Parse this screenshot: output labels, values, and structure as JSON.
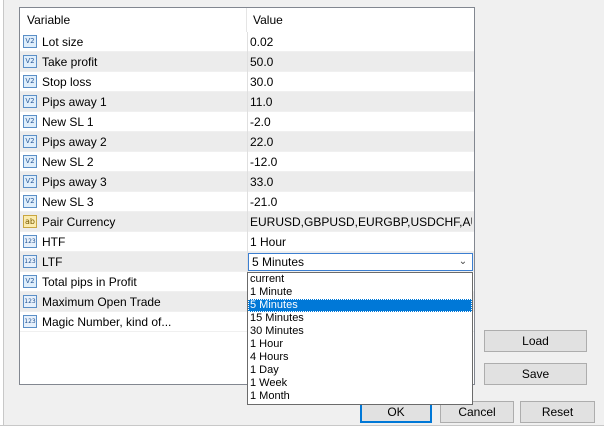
{
  "grid": {
    "headers": {
      "variable": "Variable",
      "value": "Value"
    },
    "rows": [
      {
        "icon": "double",
        "name": "Lot size",
        "value": "0.02"
      },
      {
        "icon": "double",
        "name": "Take profit",
        "value": "50.0"
      },
      {
        "icon": "double",
        "name": "Stop loss",
        "value": "30.0"
      },
      {
        "icon": "double",
        "name": "Pips away 1",
        "value": "11.0"
      },
      {
        "icon": "double",
        "name": "New SL 1",
        "value": "-2.0"
      },
      {
        "icon": "double",
        "name": "Pips away 2",
        "value": "22.0"
      },
      {
        "icon": "double",
        "name": "New SL 2",
        "value": "-12.0"
      },
      {
        "icon": "double",
        "name": "Pips away 3",
        "value": "33.0"
      },
      {
        "icon": "double",
        "name": "New SL 3",
        "value": "-21.0"
      },
      {
        "icon": "string",
        "name": "Pair Currency",
        "value": "EURUSD,GBPUSD,EURGBP,USDCHF,AU..."
      },
      {
        "icon": "integer",
        "name": "HTF",
        "value": "1 Hour"
      },
      {
        "icon": "integer",
        "name": "LTF",
        "value": "5 Minutes"
      },
      {
        "icon": "double",
        "name": "Total pips in Profit",
        "value": ""
      },
      {
        "icon": "integer",
        "name": "Maximum Open Trade",
        "value": ""
      },
      {
        "icon": "integer",
        "name": "Magic Number, kind of...",
        "value": ""
      }
    ]
  },
  "icons": {
    "double": "V2",
    "string": "ab",
    "integer": "123"
  },
  "dropdown": {
    "selected": "5 Minutes",
    "options": [
      "current",
      "1 Minute",
      "5 Minutes",
      "15 Minutes",
      "30 Minutes",
      "1 Hour",
      "4 Hours",
      "1 Day",
      "1 Week",
      "1 Month"
    ]
  },
  "buttons": {
    "load": "Load",
    "save": "Save",
    "ok": "OK",
    "cancel": "Cancel",
    "reset": "Reset"
  },
  "colors": {
    "accent": "#0078d7",
    "alt_row": "#ececec"
  }
}
